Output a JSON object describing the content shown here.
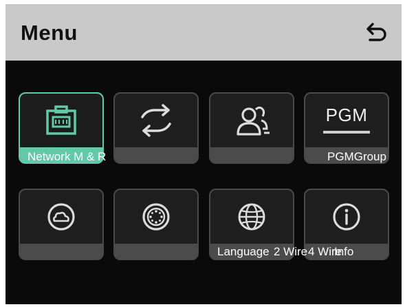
{
  "header": {
    "title": "Menu",
    "back_icon": "back-arrow-icon"
  },
  "colors": {
    "active_accent": "#63c9a8",
    "header_bg": "#c9c9c9",
    "screen_bg": "#0a0a0a"
  },
  "tiles": [
    {
      "icon": "ethernet-port-icon",
      "label": "Network M & R",
      "active": true
    },
    {
      "icon": "sync-arrows-icon",
      "label": "",
      "active": false
    },
    {
      "icon": "users-icon",
      "label": "",
      "active": false
    },
    {
      "icon": "pgm-icon",
      "icon_text": "PGM",
      "label": "PGMGroup",
      "active": false
    },
    {
      "icon": "cloud-circle-icon",
      "label": "",
      "active": false
    },
    {
      "icon": "connector-dots-icon",
      "label": "",
      "active": false
    },
    {
      "icon": "globe-icon",
      "label": "",
      "active": false
    },
    {
      "icon": "info-icon",
      "label": "",
      "active": false
    }
  ],
  "overlap_labels": {
    "language": "Language",
    "two_wire": "2 Wire",
    "four_wire": "4 Wire",
    "info": "Info"
  }
}
